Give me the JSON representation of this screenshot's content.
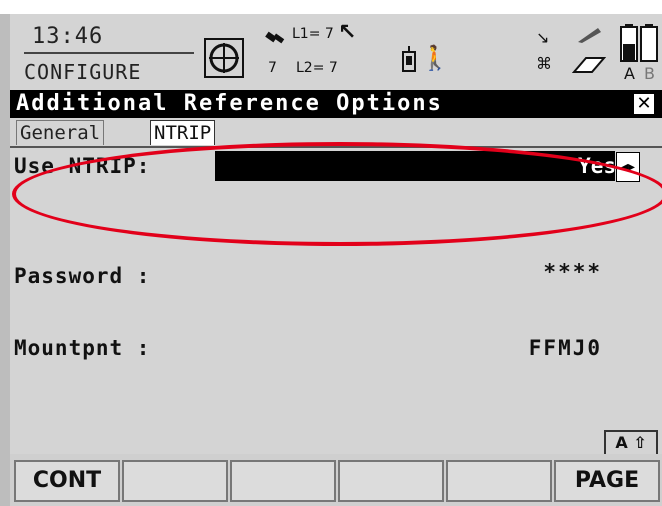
{
  "status": {
    "time": "13:46",
    "mode": "CONFIGURE",
    "l1_count": "L1= 7",
    "l2_count": "L2= 7",
    "sat_count": "7",
    "battery_labels": [
      "A",
      "B"
    ]
  },
  "title": "Additional Reference Options",
  "tabs": [
    {
      "label": "General",
      "active": false
    },
    {
      "label": "NTRIP",
      "active": true
    }
  ],
  "fields": {
    "use_ntrip": {
      "label": "Use NTRIP:",
      "value": "Yes"
    },
    "password": {
      "label": "Password :",
      "value": "****"
    },
    "mountpoint": {
      "label": "Mountpnt :",
      "value": "FFMJ0"
    }
  },
  "input_mode": "A ⇧",
  "softkeys": [
    "CONT",
    "",
    "",
    "",
    "",
    "PAGE"
  ],
  "colors": {
    "highlight": "#e2001a"
  }
}
